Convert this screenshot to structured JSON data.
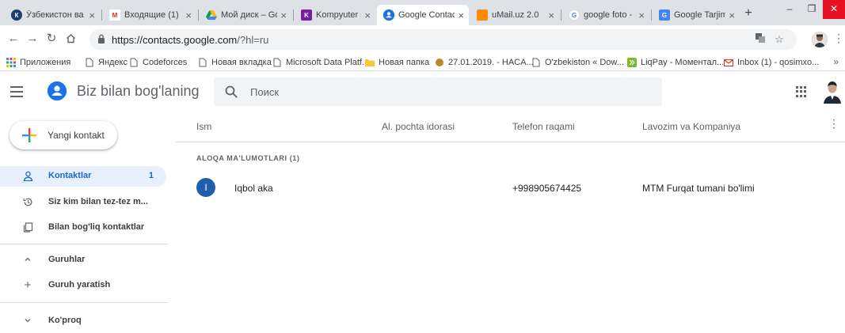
{
  "browser": {
    "tabs": [
      {
        "title": "Ўзбекистон ва",
        "favicon_color": "#1f3b73",
        "favicon_text": "К"
      },
      {
        "title": "Входящие (1)",
        "favicon_color": "#ffffff",
        "favicon_text": "M"
      },
      {
        "title": "Мой диск – Go",
        "favicon_color": "#ffffff",
        "favicon_text": ""
      },
      {
        "title": "Kompyuter sav",
        "favicon_color": "#7b1fa2",
        "favicon_text": "K"
      },
      {
        "title": "Google Contact",
        "favicon_color": "#1a73e8",
        "favicon_text": ""
      },
      {
        "title": "uMail.uz 2.0",
        "favicon_color": "#ff8a00",
        "favicon_text": ""
      },
      {
        "title": "google foto -",
        "favicon_color": "#ffffff",
        "favicon_text": "G"
      },
      {
        "title": "Google Tarjim",
        "favicon_color": "#4285f4",
        "favicon_text": "G"
      }
    ],
    "url_host": "https://contacts.google.com",
    "url_path": "/?hl=ru",
    "bookmarks": [
      "Приложения",
      "Яндекс",
      "Codeforces",
      "Новая вкладка",
      "Microsoft Data Platf...",
      "Новая папка",
      "27.01.2019. - HACA...",
      "O'zbekiston « Dow...",
      "LiqPay - Моментал...",
      "Inbox (1) - qosimxo..."
    ],
    "bookmarks_overflow": "»"
  },
  "app": {
    "title": "Biz bilan bog'laning",
    "search_placeholder": "Поиск",
    "brand_color": "#1a73e8"
  },
  "sidebar": {
    "create_label": "Yangi kontakt",
    "items": [
      {
        "label": "Kontaktlar",
        "count": "1",
        "icon": "person-icon"
      },
      {
        "label": "Siz kim bilan tez-tez m...",
        "icon": "history-icon"
      },
      {
        "label": "Bilan bog'liq kontaktlar",
        "icon": "copy-icon"
      },
      {
        "label": "Guruhlar",
        "icon": "chevron-up-icon"
      },
      {
        "label": "Guruh yaratish",
        "icon": "plus-icon"
      },
      {
        "label": "Ko'proq",
        "icon": "chevron-down-icon"
      }
    ]
  },
  "table": {
    "columns": [
      "Ism",
      "Al. pochta idorasi",
      "Telefon raqami",
      "Lavozim va Kompaniya"
    ],
    "section_label": "ALOQA MA'LUMOTLARI (1)",
    "rows": [
      {
        "initial": "I",
        "name": "Iqbol aka",
        "email": "",
        "phone": "+998905674425",
        "job": "MTM Furqat tumani bo'limi"
      }
    ]
  }
}
